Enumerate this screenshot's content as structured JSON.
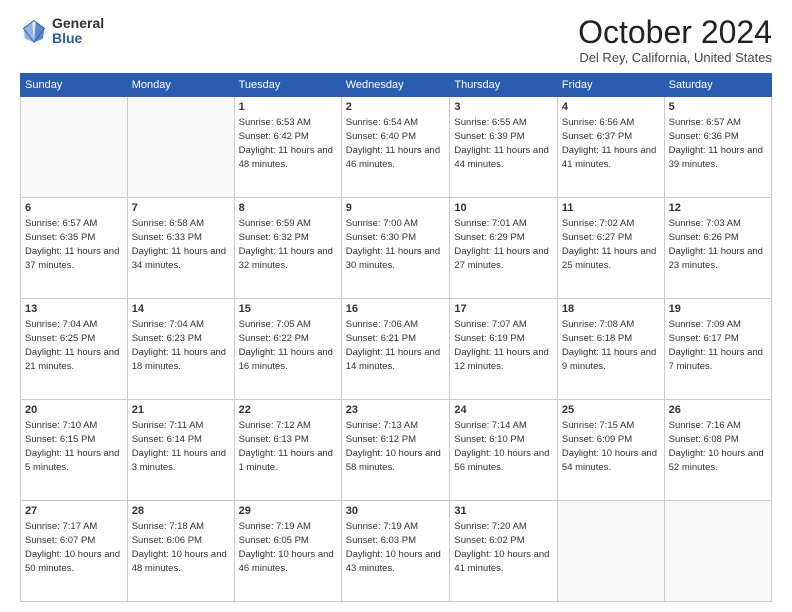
{
  "logo": {
    "general": "General",
    "blue": "Blue"
  },
  "title": "October 2024",
  "location": "Del Rey, California, United States",
  "days_of_week": [
    "Sunday",
    "Monday",
    "Tuesday",
    "Wednesday",
    "Thursday",
    "Friday",
    "Saturday"
  ],
  "weeks": [
    [
      {
        "day": "",
        "info": ""
      },
      {
        "day": "",
        "info": ""
      },
      {
        "day": "1",
        "info": "Sunrise: 6:53 AM\nSunset: 6:42 PM\nDaylight: 11 hours and 48 minutes."
      },
      {
        "day": "2",
        "info": "Sunrise: 6:54 AM\nSunset: 6:40 PM\nDaylight: 11 hours and 46 minutes."
      },
      {
        "day": "3",
        "info": "Sunrise: 6:55 AM\nSunset: 6:39 PM\nDaylight: 11 hours and 44 minutes."
      },
      {
        "day": "4",
        "info": "Sunrise: 6:56 AM\nSunset: 6:37 PM\nDaylight: 11 hours and 41 minutes."
      },
      {
        "day": "5",
        "info": "Sunrise: 6:57 AM\nSunset: 6:36 PM\nDaylight: 11 hours and 39 minutes."
      }
    ],
    [
      {
        "day": "6",
        "info": "Sunrise: 6:57 AM\nSunset: 6:35 PM\nDaylight: 11 hours and 37 minutes."
      },
      {
        "day": "7",
        "info": "Sunrise: 6:58 AM\nSunset: 6:33 PM\nDaylight: 11 hours and 34 minutes."
      },
      {
        "day": "8",
        "info": "Sunrise: 6:59 AM\nSunset: 6:32 PM\nDaylight: 11 hours and 32 minutes."
      },
      {
        "day": "9",
        "info": "Sunrise: 7:00 AM\nSunset: 6:30 PM\nDaylight: 11 hours and 30 minutes."
      },
      {
        "day": "10",
        "info": "Sunrise: 7:01 AM\nSunset: 6:29 PM\nDaylight: 11 hours and 27 minutes."
      },
      {
        "day": "11",
        "info": "Sunrise: 7:02 AM\nSunset: 6:27 PM\nDaylight: 11 hours and 25 minutes."
      },
      {
        "day": "12",
        "info": "Sunrise: 7:03 AM\nSunset: 6:26 PM\nDaylight: 11 hours and 23 minutes."
      }
    ],
    [
      {
        "day": "13",
        "info": "Sunrise: 7:04 AM\nSunset: 6:25 PM\nDaylight: 11 hours and 21 minutes."
      },
      {
        "day": "14",
        "info": "Sunrise: 7:04 AM\nSunset: 6:23 PM\nDaylight: 11 hours and 18 minutes."
      },
      {
        "day": "15",
        "info": "Sunrise: 7:05 AM\nSunset: 6:22 PM\nDaylight: 11 hours and 16 minutes."
      },
      {
        "day": "16",
        "info": "Sunrise: 7:06 AM\nSunset: 6:21 PM\nDaylight: 11 hours and 14 minutes."
      },
      {
        "day": "17",
        "info": "Sunrise: 7:07 AM\nSunset: 6:19 PM\nDaylight: 11 hours and 12 minutes."
      },
      {
        "day": "18",
        "info": "Sunrise: 7:08 AM\nSunset: 6:18 PM\nDaylight: 11 hours and 9 minutes."
      },
      {
        "day": "19",
        "info": "Sunrise: 7:09 AM\nSunset: 6:17 PM\nDaylight: 11 hours and 7 minutes."
      }
    ],
    [
      {
        "day": "20",
        "info": "Sunrise: 7:10 AM\nSunset: 6:15 PM\nDaylight: 11 hours and 5 minutes."
      },
      {
        "day": "21",
        "info": "Sunrise: 7:11 AM\nSunset: 6:14 PM\nDaylight: 11 hours and 3 minutes."
      },
      {
        "day": "22",
        "info": "Sunrise: 7:12 AM\nSunset: 6:13 PM\nDaylight: 11 hours and 1 minute."
      },
      {
        "day": "23",
        "info": "Sunrise: 7:13 AM\nSunset: 6:12 PM\nDaylight: 10 hours and 58 minutes."
      },
      {
        "day": "24",
        "info": "Sunrise: 7:14 AM\nSunset: 6:10 PM\nDaylight: 10 hours and 56 minutes."
      },
      {
        "day": "25",
        "info": "Sunrise: 7:15 AM\nSunset: 6:09 PM\nDaylight: 10 hours and 54 minutes."
      },
      {
        "day": "26",
        "info": "Sunrise: 7:16 AM\nSunset: 6:08 PM\nDaylight: 10 hours and 52 minutes."
      }
    ],
    [
      {
        "day": "27",
        "info": "Sunrise: 7:17 AM\nSunset: 6:07 PM\nDaylight: 10 hours and 50 minutes."
      },
      {
        "day": "28",
        "info": "Sunrise: 7:18 AM\nSunset: 6:06 PM\nDaylight: 10 hours and 48 minutes."
      },
      {
        "day": "29",
        "info": "Sunrise: 7:19 AM\nSunset: 6:05 PM\nDaylight: 10 hours and 46 minutes."
      },
      {
        "day": "30",
        "info": "Sunrise: 7:19 AM\nSunset: 6:03 PM\nDaylight: 10 hours and 43 minutes."
      },
      {
        "day": "31",
        "info": "Sunrise: 7:20 AM\nSunset: 6:02 PM\nDaylight: 10 hours and 41 minutes."
      },
      {
        "day": "",
        "info": ""
      },
      {
        "day": "",
        "info": ""
      }
    ]
  ]
}
